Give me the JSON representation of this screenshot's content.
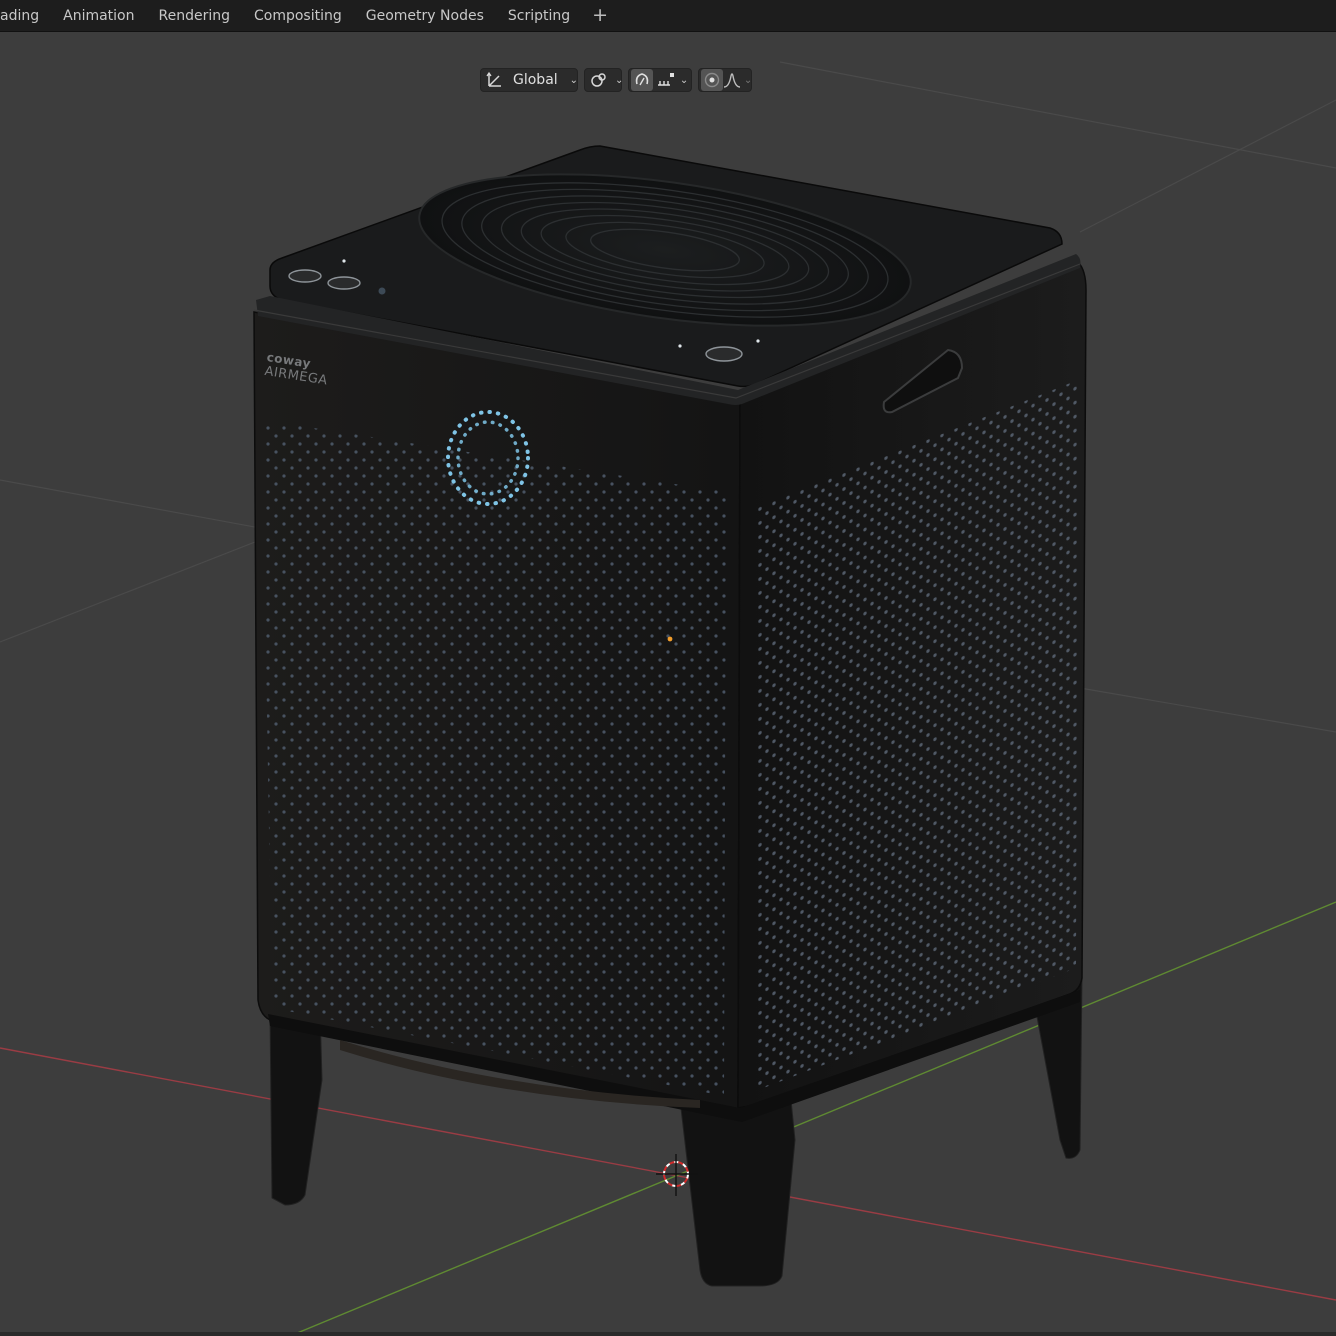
{
  "workspace_tabs": [
    {
      "label": "ading"
    },
    {
      "label": "Animation"
    },
    {
      "label": "Rendering"
    },
    {
      "label": "Compositing"
    },
    {
      "label": "Geometry Nodes"
    },
    {
      "label": "Scripting"
    }
  ],
  "add_tab_label": "+",
  "viewport_header": {
    "transform_orientation": "Global",
    "icons": [
      "transform-orientation-icon",
      "pivot-point-icon",
      "snap-icon",
      "snap-increment-icon",
      "proportional-edit-icon",
      "falloff-curve-icon"
    ]
  },
  "model": {
    "brand": "coway",
    "product": "AIRMEGA"
  },
  "colors": {
    "tabbar": "#1d1d1d",
    "viewport_bg": "#3d3d3d",
    "x_axis": "#9a3c44",
    "y_axis": "#5f8a32",
    "indicator_ring": "#7fc4e6"
  }
}
